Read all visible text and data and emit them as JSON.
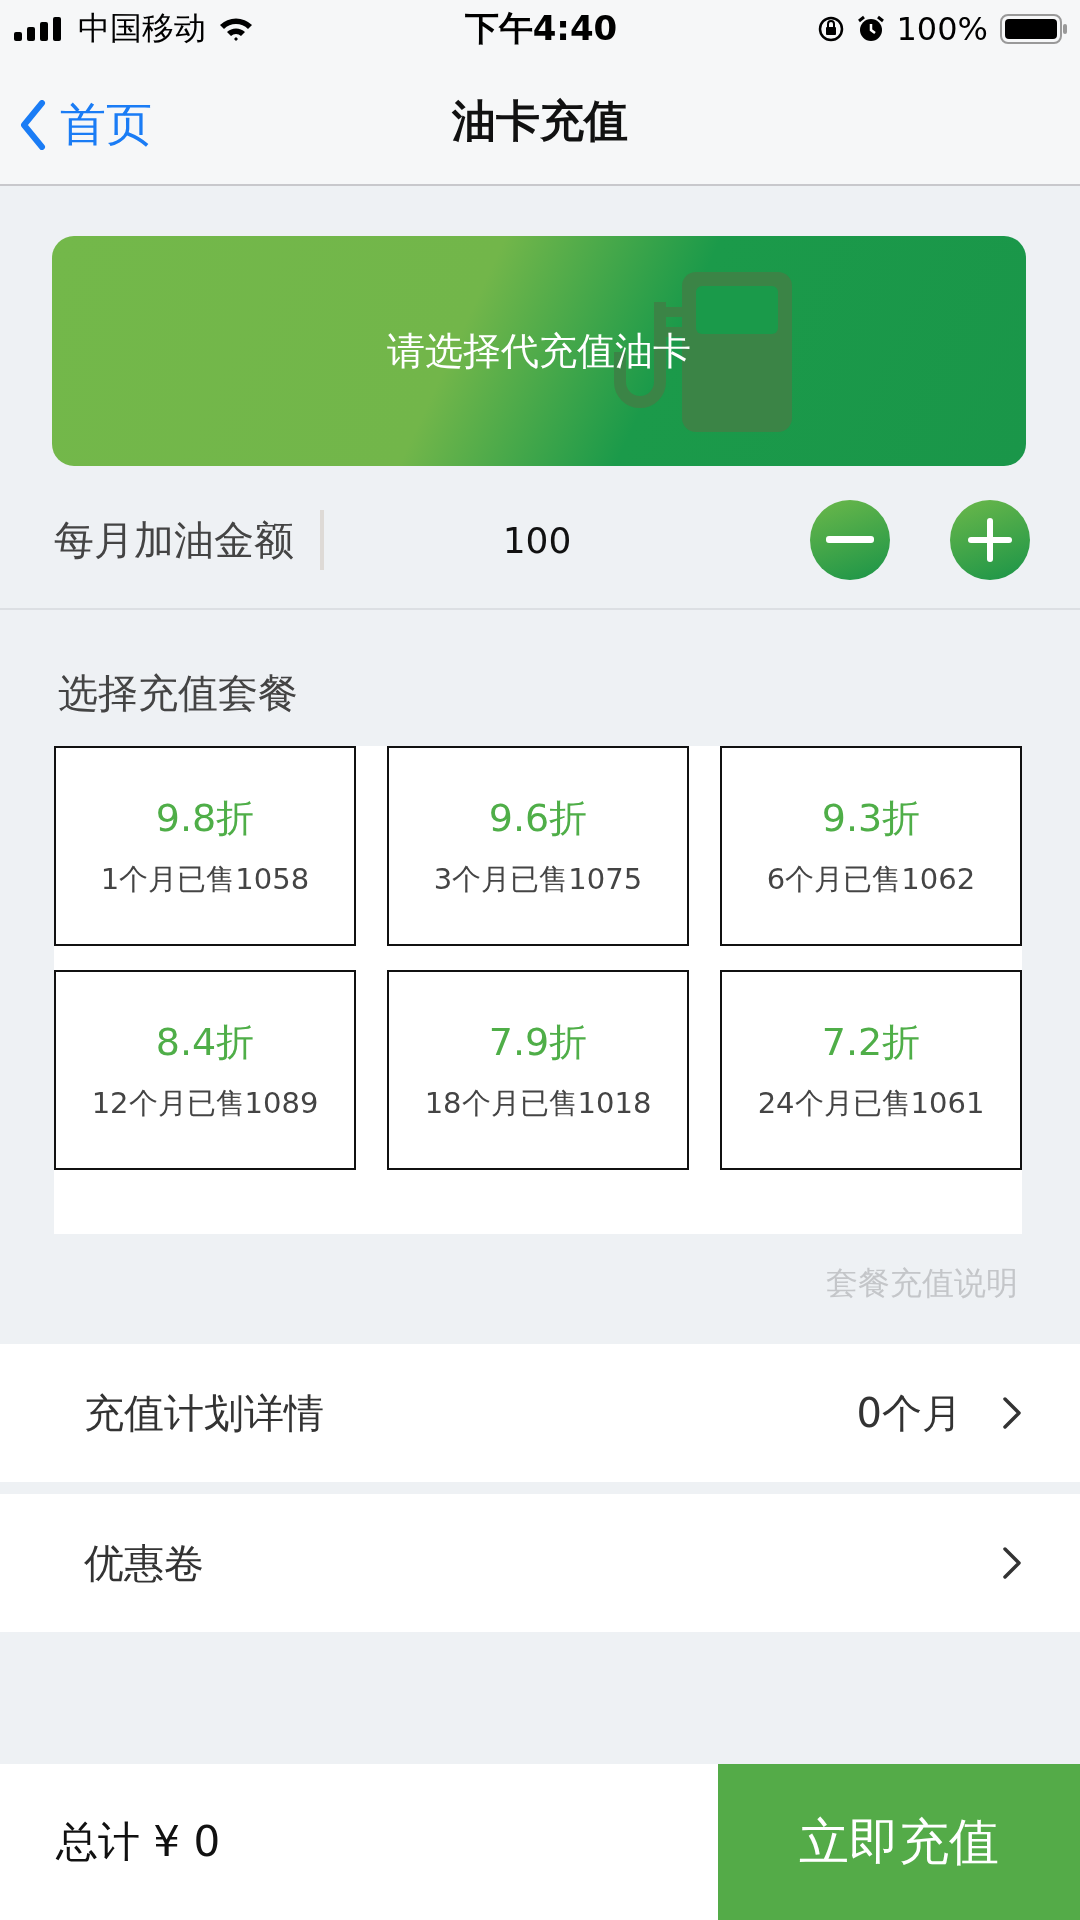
{
  "status_bar": {
    "carrier": "中国移动",
    "time": "下午4:40",
    "battery": "100%"
  },
  "nav": {
    "back": "首页",
    "title": "油卡充值"
  },
  "card_banner": {
    "text": "请选择代充值油卡"
  },
  "amount": {
    "label": "每月加油金额",
    "value": "100"
  },
  "packages": {
    "title": "选择充值套餐",
    "items": [
      {
        "discount": "9.8折",
        "sold": "1个月已售1058"
      },
      {
        "discount": "9.6折",
        "sold": "3个月已售1075"
      },
      {
        "discount": "9.3折",
        "sold": "6个月已售1062"
      },
      {
        "discount": "8.4折",
        "sold": "12个月已售1089"
      },
      {
        "discount": "7.9折",
        "sold": "18个月已售1018"
      },
      {
        "discount": "7.2折",
        "sold": "24个月已售1061"
      }
    ],
    "note_link": "套餐充值说明"
  },
  "rows": [
    {
      "label": "充值计划详情",
      "value": "0个月"
    },
    {
      "label": "优惠卷"
    }
  ],
  "footer": {
    "total": "总计 ¥ 0",
    "button": "立即充值"
  }
}
